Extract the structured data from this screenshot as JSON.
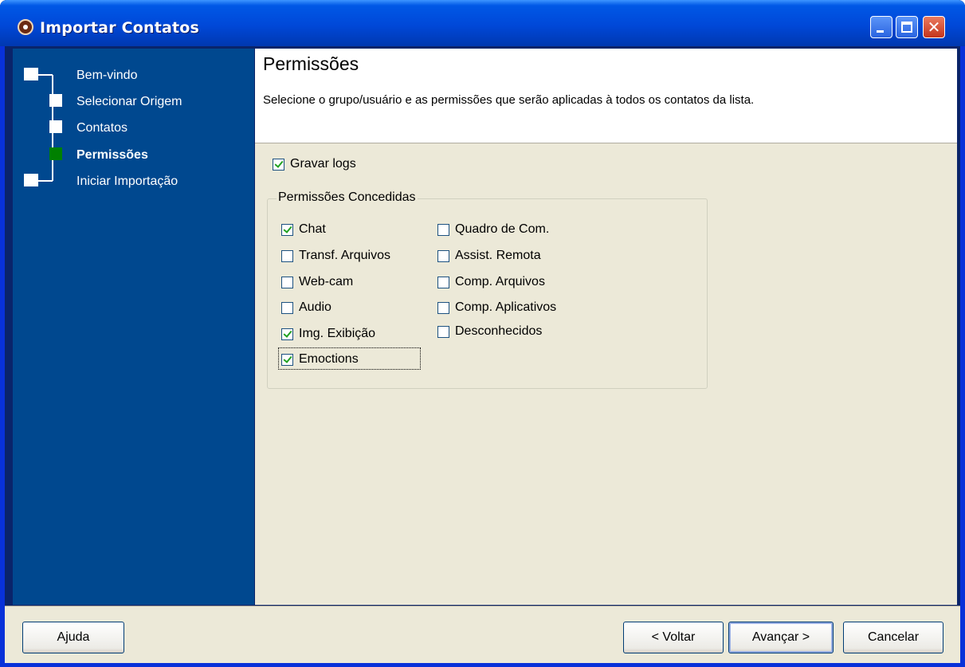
{
  "window": {
    "title": "Importar Contatos",
    "icons": {
      "app": "app-icon",
      "minimize": "minimize-icon",
      "maximize": "maximize-icon",
      "close": "close-icon"
    },
    "close_glyph": "✕"
  },
  "sidebar": {
    "steps": [
      {
        "label": "Bem-vindo",
        "state": "done"
      },
      {
        "label": "Selecionar Origem",
        "state": "done"
      },
      {
        "label": "Contatos",
        "state": "done"
      },
      {
        "label": "Permissões",
        "state": "current"
      },
      {
        "label": "Iniciar Importação",
        "state": "pending"
      }
    ]
  },
  "header": {
    "title": "Permissões",
    "description": "Selecione o grupo/usuário e as permissões que serão aplicadas à todos os contatos da lista."
  },
  "main": {
    "log_checkbox": {
      "label": "Gravar logs",
      "checked": true
    },
    "permissions_group": {
      "title": "Permissões Concedidas",
      "left_column": [
        {
          "label": "Chat",
          "checked": true
        },
        {
          "label": "Transf. Arquivos",
          "checked": false
        },
        {
          "label": "Web-cam",
          "checked": false
        },
        {
          "label": "Audio",
          "checked": false
        },
        {
          "label": "Img. Exibição",
          "checked": true
        },
        {
          "label": "Emoctions",
          "checked": true,
          "focused": true
        }
      ],
      "right_column": [
        {
          "label": "Quadro de Com.",
          "checked": false
        },
        {
          "label": "Assist. Remota",
          "checked": false
        },
        {
          "label": "Comp. Arquivos",
          "checked": false
        },
        {
          "label": "Comp. Aplicativos",
          "checked": false
        },
        {
          "label": "Desconhecidos",
          "checked": false
        }
      ]
    }
  },
  "footer": {
    "help_label": "Ajuda",
    "back_label": "< Voltar",
    "next_label": "Avançar >",
    "cancel_label": "Cancelar"
  },
  "colors": {
    "sidebar_bg": "#00488f",
    "current_step": "#008000",
    "dialog_bg": "#ece9d8",
    "titlebar": "#0048d8"
  }
}
